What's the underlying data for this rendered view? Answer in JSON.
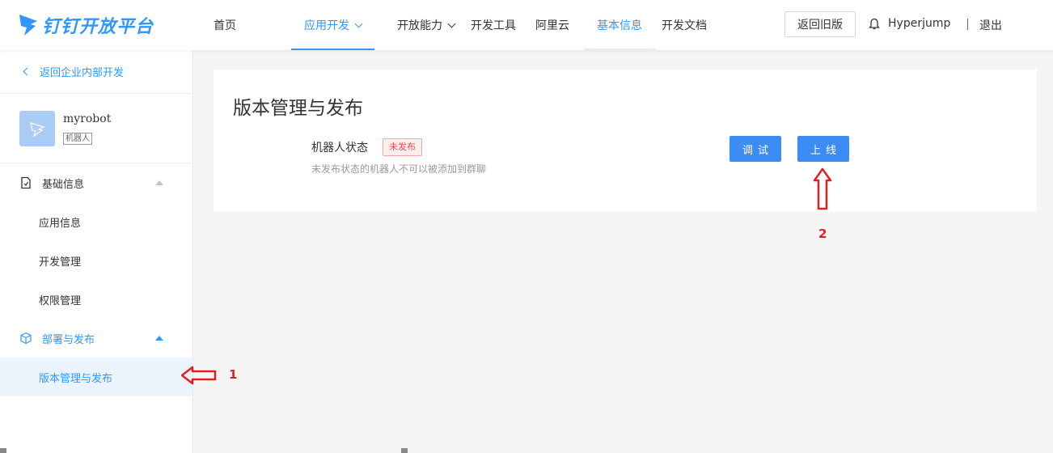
{
  "header": {
    "logo_text": "钉钉开放平台",
    "nav": [
      {
        "label": "首页"
      },
      {
        "label": "应用开发"
      },
      {
        "label": "开放能力"
      },
      {
        "label": "开发工具"
      },
      {
        "label": "阿里云"
      },
      {
        "label": "基本信息"
      },
      {
        "label": "开发文档"
      }
    ],
    "old_version_label": "返回旧版",
    "username": "Hyperjump",
    "logout_label": "退出"
  },
  "sidebar": {
    "back_label": "返回企业内部开发",
    "app_name": "myrobot",
    "app_tag": "机器人",
    "groups": [
      {
        "label": "基础信息",
        "items": [
          {
            "label": "应用信息"
          },
          {
            "label": "开发管理"
          },
          {
            "label": "权限管理"
          }
        ]
      },
      {
        "label": "部署与发布",
        "items": [
          {
            "label": "版本管理与发布"
          }
        ]
      }
    ]
  },
  "main": {
    "title": "版本管理与发布",
    "status_label": "机器人状态",
    "status_badge": "未发布",
    "status_desc": "未发布状态的机器人不可以被添加到群聊",
    "debug_label": "调试",
    "online_label": "上线"
  },
  "annotations": {
    "marker_1": "1",
    "marker_2": "2"
  },
  "colors": {
    "accent": "#3296fa",
    "annotation": "#e02020"
  }
}
